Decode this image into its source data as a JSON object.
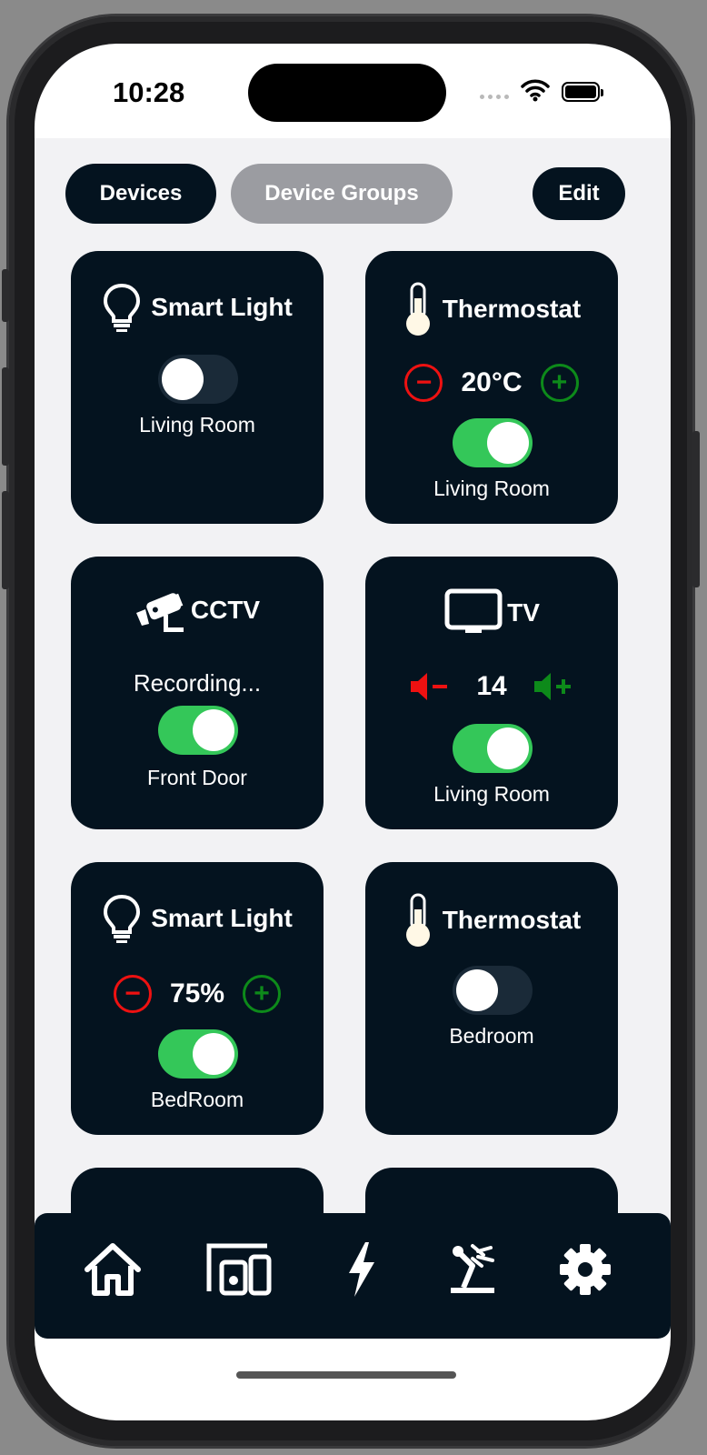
{
  "status": {
    "time": "10:28"
  },
  "tabs": {
    "devices": "Devices",
    "device_groups": "Device Groups",
    "edit": "Edit"
  },
  "cards": [
    {
      "title": "Smart Light",
      "icon": "bulb-icon",
      "room": "Living Room",
      "on": false
    },
    {
      "title": "Thermostat",
      "icon": "thermometer-icon",
      "value": "20°C",
      "room": "Living Room",
      "on": true
    },
    {
      "title": "CCTV",
      "icon": "cctv-icon",
      "status": "Recording...",
      "room": "Front Door",
      "on": true
    },
    {
      "title": "TV",
      "icon": "tv-icon",
      "value": "14",
      "room": "Living Room",
      "on": true
    },
    {
      "title": "Smart Light",
      "icon": "bulb-icon",
      "value": "75%",
      "room": "BedRoom",
      "on": true
    },
    {
      "title": "Thermostat",
      "icon": "thermometer-icon",
      "room": "Bedroom",
      "on": false
    }
  ],
  "tabbar": [
    "home-icon",
    "devices-icon",
    "energy-icon",
    "automation-icon",
    "settings-icon"
  ],
  "colors": {
    "card": "#04131f",
    "toggle_on": "#34c759",
    "minus": "#e11111",
    "plus": "#0d8a1a",
    "groups_tab": "#9b9ca1"
  }
}
